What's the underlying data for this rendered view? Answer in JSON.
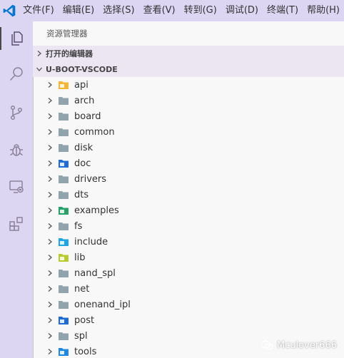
{
  "titlebar": {
    "menus": [
      "文件(F)",
      "编辑(E)",
      "选择(S)",
      "查看(V)",
      "转到(G)",
      "调试(D)",
      "终端(T)",
      "帮助(H)"
    ]
  },
  "activitybar": {
    "icons": [
      "explorer-icon",
      "search-icon",
      "source-control-icon",
      "debug-icon",
      "remote-explorer-icon",
      "extensions-icon"
    ]
  },
  "sidebar": {
    "title": "资源管理器",
    "open_editors_label": "打开的编辑器",
    "workspace_label": "U-BOOT-VSCODE"
  },
  "tree": [
    {
      "name": "api",
      "folder_color": "#f5b731",
      "badge": "api"
    },
    {
      "name": "arch",
      "folder_color": "#90a4ae"
    },
    {
      "name": "board",
      "folder_color": "#90a4ae"
    },
    {
      "name": "common",
      "folder_color": "#90a4ae"
    },
    {
      "name": "disk",
      "folder_color": "#90a4ae"
    },
    {
      "name": "doc",
      "folder_color": "#1e6bd6",
      "badge": "doc"
    },
    {
      "name": "drivers",
      "folder_color": "#90a4ae"
    },
    {
      "name": "dts",
      "folder_color": "#90a4ae"
    },
    {
      "name": "examples",
      "folder_color": "#26a269",
      "badge": "examples"
    },
    {
      "name": "fs",
      "folder_color": "#90a4ae"
    },
    {
      "name": "include",
      "folder_color": "#1ea5e8",
      "badge": "include"
    },
    {
      "name": "lib",
      "folder_color": "#b7cc2a",
      "badge": "lib"
    },
    {
      "name": "nand_spl",
      "folder_color": "#90a4ae"
    },
    {
      "name": "net",
      "folder_color": "#90a4ae"
    },
    {
      "name": "onenand_ipl",
      "folder_color": "#90a4ae"
    },
    {
      "name": "post",
      "folder_color": "#1e6bd6",
      "badge": "post"
    },
    {
      "name": "spl",
      "folder_color": "#90a4ae"
    },
    {
      "name": "tools",
      "folder_color": "#1e88e5",
      "badge": "tools"
    }
  ],
  "watermark": {
    "text": "Mculover666"
  },
  "colors": {
    "accent": "#0078d4",
    "titlebar_bg": "#ddd6f3",
    "sidebar_bg": "#f8f8f8"
  }
}
